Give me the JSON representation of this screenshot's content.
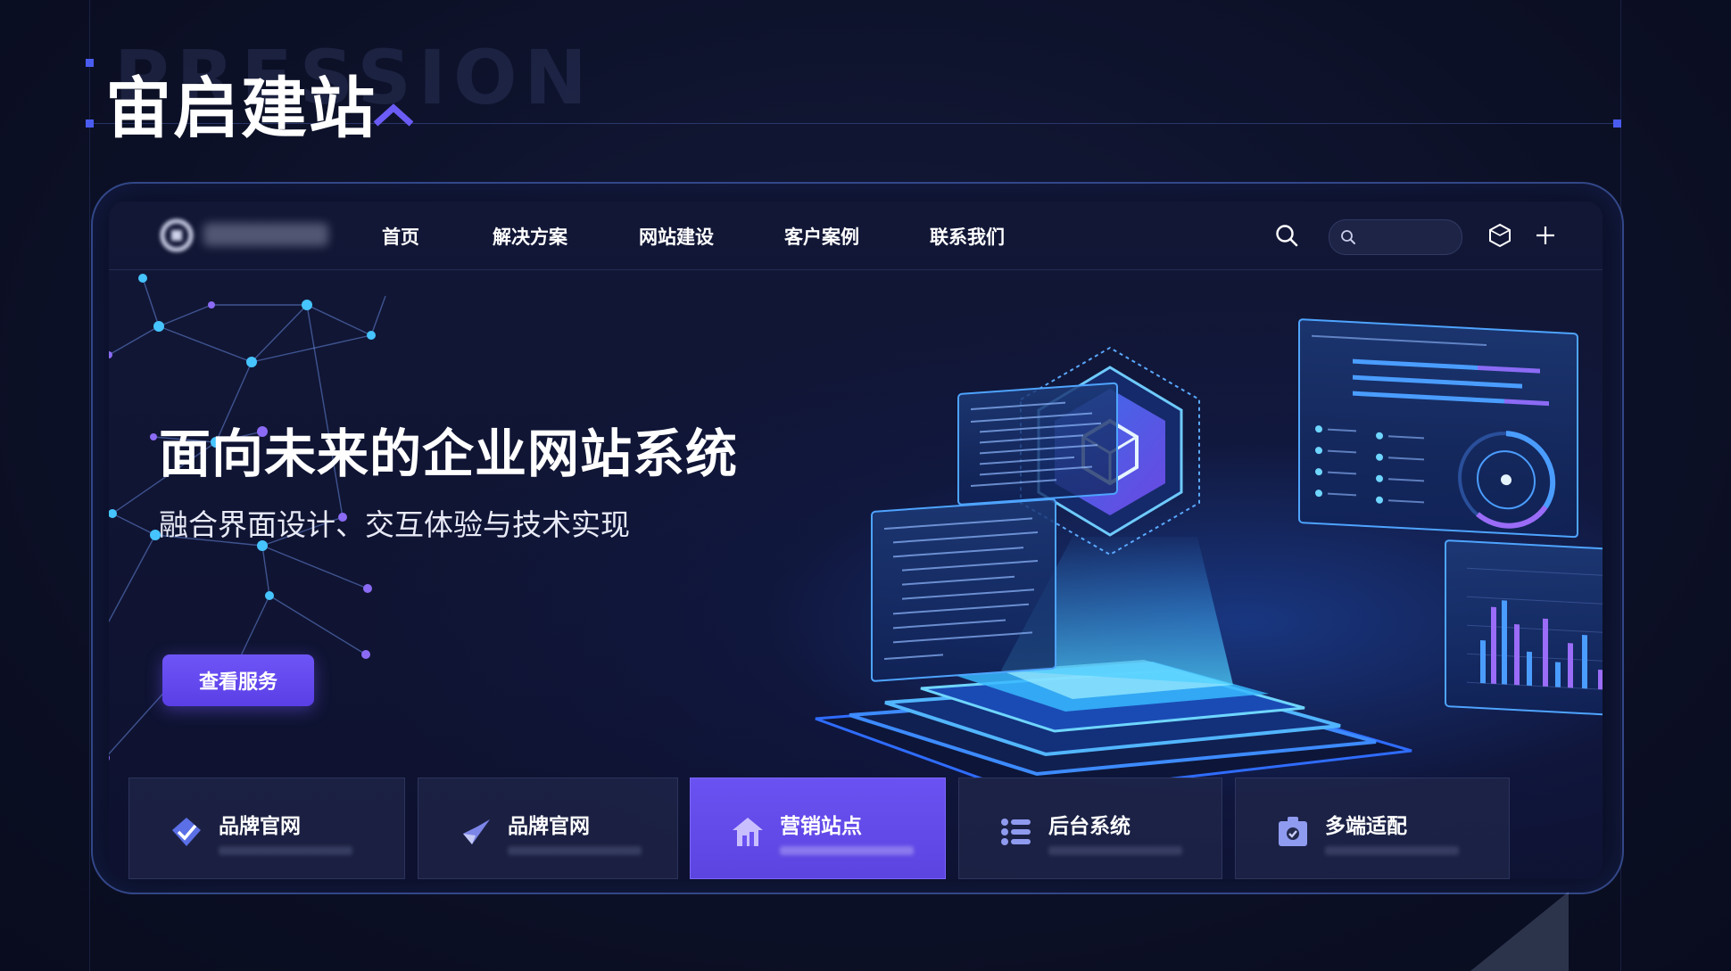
{
  "slide": {
    "title": "宙启建站",
    "ghost_text": "PRESSION"
  },
  "navbar": {
    "logo_icon": "brand-logo-icon",
    "items": [
      {
        "label": "首页"
      },
      {
        "label": "解决方案"
      },
      {
        "label": "网站建设"
      },
      {
        "label": "客户案例"
      },
      {
        "label": "联系我们"
      }
    ],
    "search_icon": "search-icon",
    "search_placeholder": "",
    "cube_icon": "cube-icon",
    "plus_icon": "plus-icon"
  },
  "hero": {
    "title": "面向未来的企业网站系统",
    "subtitle": "融合界面设计、交互体验与技术实现",
    "cta_label": "查看服务"
  },
  "cards": [
    {
      "title": "品牌官网",
      "icon": "diamond-check-icon",
      "active": false
    },
    {
      "title": "品牌官网",
      "icon": "feather-check-icon",
      "active": false
    },
    {
      "title": "营销站点",
      "icon": "house-chart-icon",
      "active": true
    },
    {
      "title": "后台系统",
      "icon": "list-icon",
      "active": false
    },
    {
      "title": "多端适配",
      "icon": "devices-icon",
      "active": false
    }
  ],
  "colors": {
    "accent": "#6e55f7",
    "glow": "#2f8bff",
    "background": "#0c1026"
  }
}
